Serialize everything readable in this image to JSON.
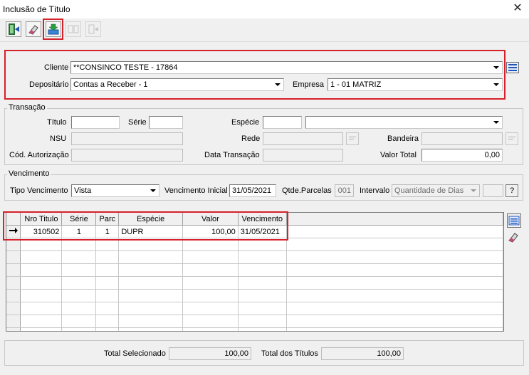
{
  "window": {
    "title": "Inclusão de Título",
    "close": "✕"
  },
  "toolbar": {
    "buttons": [
      {
        "icon": "exit-door-icon",
        "enabled": true
      },
      {
        "icon": "eraser-icon",
        "enabled": true
      },
      {
        "icon": "save-import-icon",
        "enabled": true
      },
      {
        "icon": "disabled-tool-icon",
        "enabled": false
      },
      {
        "icon": "disabled-tool-icon",
        "enabled": false
      }
    ]
  },
  "cliente": {
    "label": "Cliente",
    "value": "**CONSINCO TESTE - 17864"
  },
  "depositario": {
    "label": "Depositário",
    "value": "Contas a Receber - 1"
  },
  "empresa": {
    "label": "Empresa",
    "value": "1 - 01 MATRIZ"
  },
  "transacao": {
    "title": "Transação",
    "titulo_label": "Título",
    "titulo_value": "",
    "serie_label": "Série",
    "serie_value": "",
    "especie_label": "Espécie",
    "especie_code": "",
    "especie_desc": "",
    "nsu_label": "NSU",
    "nsu_value": "",
    "rede_label": "Rede",
    "rede_value": "",
    "bandeira_label": "Bandeira",
    "bandeira_value": "",
    "cod_aut_label": "Cód. Autorização",
    "cod_aut_value": "",
    "data_trans_label": "Data Transação",
    "data_trans_value": "",
    "valor_total_label": "Valor Total",
    "valor_total_value": "0,00"
  },
  "vencimento": {
    "title": "Vencimento",
    "tipo_label": "Tipo Vencimento",
    "tipo_value": "Vista",
    "inicial_label": "Vencimento Inicial",
    "inicial_value": "31/05/2021",
    "qtde_label": "Qtde.Parcelas",
    "qtde_value": "001",
    "intervalo_label": "Intervalo",
    "intervalo_value": "Quantidade de Dias",
    "intervalo_num": "",
    "help_label": "?"
  },
  "grid": {
    "columns": [
      "Nro Titulo",
      "Série",
      "Parc",
      "Espécie",
      "Valor",
      "Vencimento"
    ],
    "rows": [
      {
        "nro": "310502",
        "serie": "1",
        "parc": "1",
        "especie": "DUPR",
        "valor": "100,00",
        "vencimento": "31/05/2021"
      }
    ],
    "empty_rows": 8
  },
  "footer": {
    "total_sel_label": "Total Selecionado",
    "total_sel_value": "100,00",
    "total_tit_label": "Total dos Títulos",
    "total_tit_value": "100,00"
  }
}
